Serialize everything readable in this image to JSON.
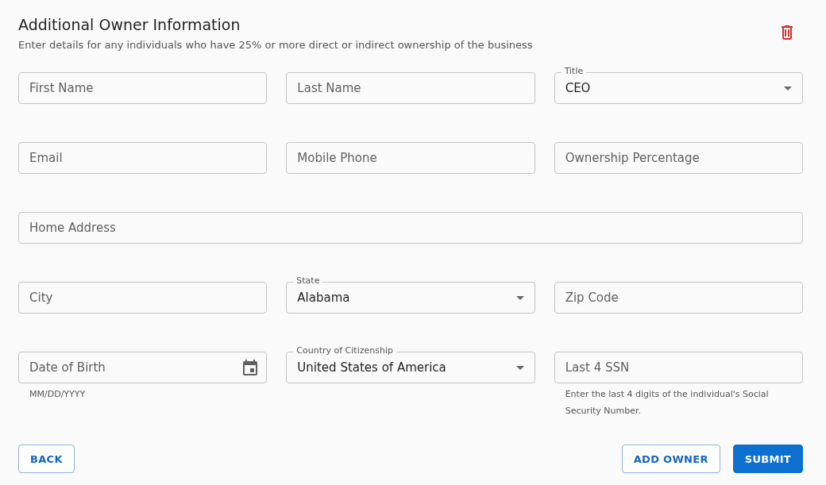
{
  "header": {
    "title": "Additional Owner Information",
    "subtitle": "Enter details for any individuals who have 25% or more direct or indirect ownership of the business"
  },
  "rows": [
    {
      "fields": [
        {
          "kind": "text",
          "placeholder": "First Name"
        },
        {
          "kind": "text",
          "placeholder": "Last Name"
        },
        {
          "kind": "select",
          "label": "Title",
          "value": "CEO"
        }
      ]
    },
    {
      "fields": [
        {
          "kind": "text",
          "placeholder": "Email"
        },
        {
          "kind": "text",
          "placeholder": "Mobile Phone"
        },
        {
          "kind": "text",
          "placeholder": "Ownership Percentage"
        }
      ]
    },
    {
      "fields": [
        {
          "kind": "text",
          "placeholder": "Home Address"
        }
      ]
    },
    {
      "fields": [
        {
          "kind": "text",
          "placeholder": "City"
        },
        {
          "kind": "select",
          "label": "State",
          "value": "Alabama"
        },
        {
          "kind": "text",
          "placeholder": "Zip Code"
        }
      ]
    },
    {
      "fields": [
        {
          "kind": "date",
          "placeholder": "Date of Birth",
          "helper": "MM/DD/YYYY"
        },
        {
          "kind": "select",
          "label": "Country of Citizenship",
          "value": "United States of America"
        },
        {
          "kind": "text",
          "placeholder": "Last 4 SSN",
          "helper": "Enter the last 4 digits of the individual's Social Security Number."
        }
      ]
    }
  ],
  "actions": {
    "left": [
      {
        "label": "BACK",
        "kind": "outlined"
      }
    ],
    "right": [
      {
        "label": "ADD OWNER",
        "kind": "outlined"
      },
      {
        "label": "SUBMIT",
        "kind": "contained"
      }
    ]
  }
}
